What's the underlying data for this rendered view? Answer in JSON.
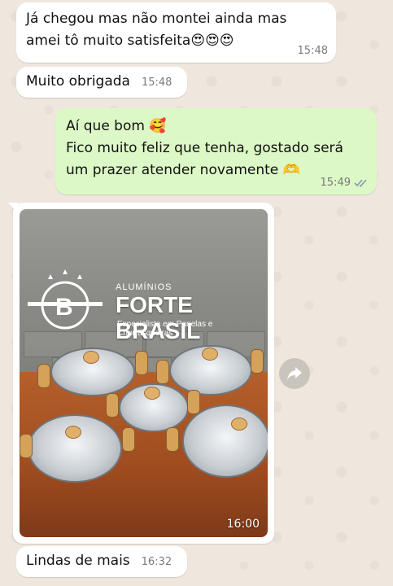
{
  "messages": [
    {
      "text_line1": "Já chegou mas não montei ainda mas",
      "text_line2": "amei tô muito satisfeita",
      "emojis": "😍😍😍",
      "time": "15:48"
    },
    {
      "text": "Muito obrigada",
      "time": "15:48"
    },
    {
      "line1": "Aí que bom",
      "emoji1": "🥰",
      "line2": "Fico muito feliz que tenha, gostado será",
      "line3": "um prazer atender novamente",
      "emoji2": "🫶",
      "time": "15:49",
      "status_icon": "double-check-icon"
    },
    {
      "photo_logo_small": "ALUMÍNIOS",
      "photo_logo_big": "FORTE BRASIL",
      "photo_logo_tag": "Especialista em Panelas e Churrasqueiras",
      "time": "16:00"
    },
    {
      "text": "Lindas de mais",
      "time": "16:32"
    }
  ],
  "share_icon": "share-forward-icon"
}
